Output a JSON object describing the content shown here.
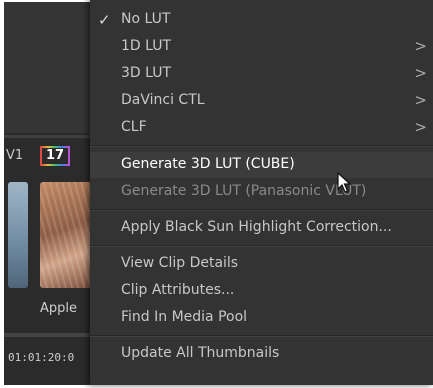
{
  "timeline": {
    "track_label": "V1",
    "clip_count": "17",
    "clip_name": "Apple",
    "timecode": "01:01:20:0"
  },
  "menu": {
    "items": [
      {
        "label": "No LUT",
        "checked": true
      },
      {
        "label": "1D LUT",
        "submenu": true
      },
      {
        "label": "3D LUT",
        "submenu": true
      },
      {
        "label": "DaVinci CTL",
        "submenu": true
      },
      {
        "label": "CLF",
        "submenu": true
      },
      {
        "label": "Generate 3D LUT (CUBE)",
        "highlighted": true
      },
      {
        "label": "Generate 3D LUT (Panasonic VLUT)",
        "dimmed": true
      },
      {
        "label": "Apply Black Sun Highlight Correction..."
      },
      {
        "label": "View Clip Details"
      },
      {
        "label": "Clip Attributes..."
      },
      {
        "label": "Find In Media Pool"
      },
      {
        "label": "Update All Thumbnails"
      }
    ]
  },
  "icons": {
    "check": "checkmark-icon",
    "submenu": "chevron-right-icon",
    "pointer": "mouse-pointer-icon"
  },
  "colors": {
    "menu_bg": "#333333",
    "highlight_bg": "#3c3c3c",
    "text": "#c8c8c8"
  }
}
